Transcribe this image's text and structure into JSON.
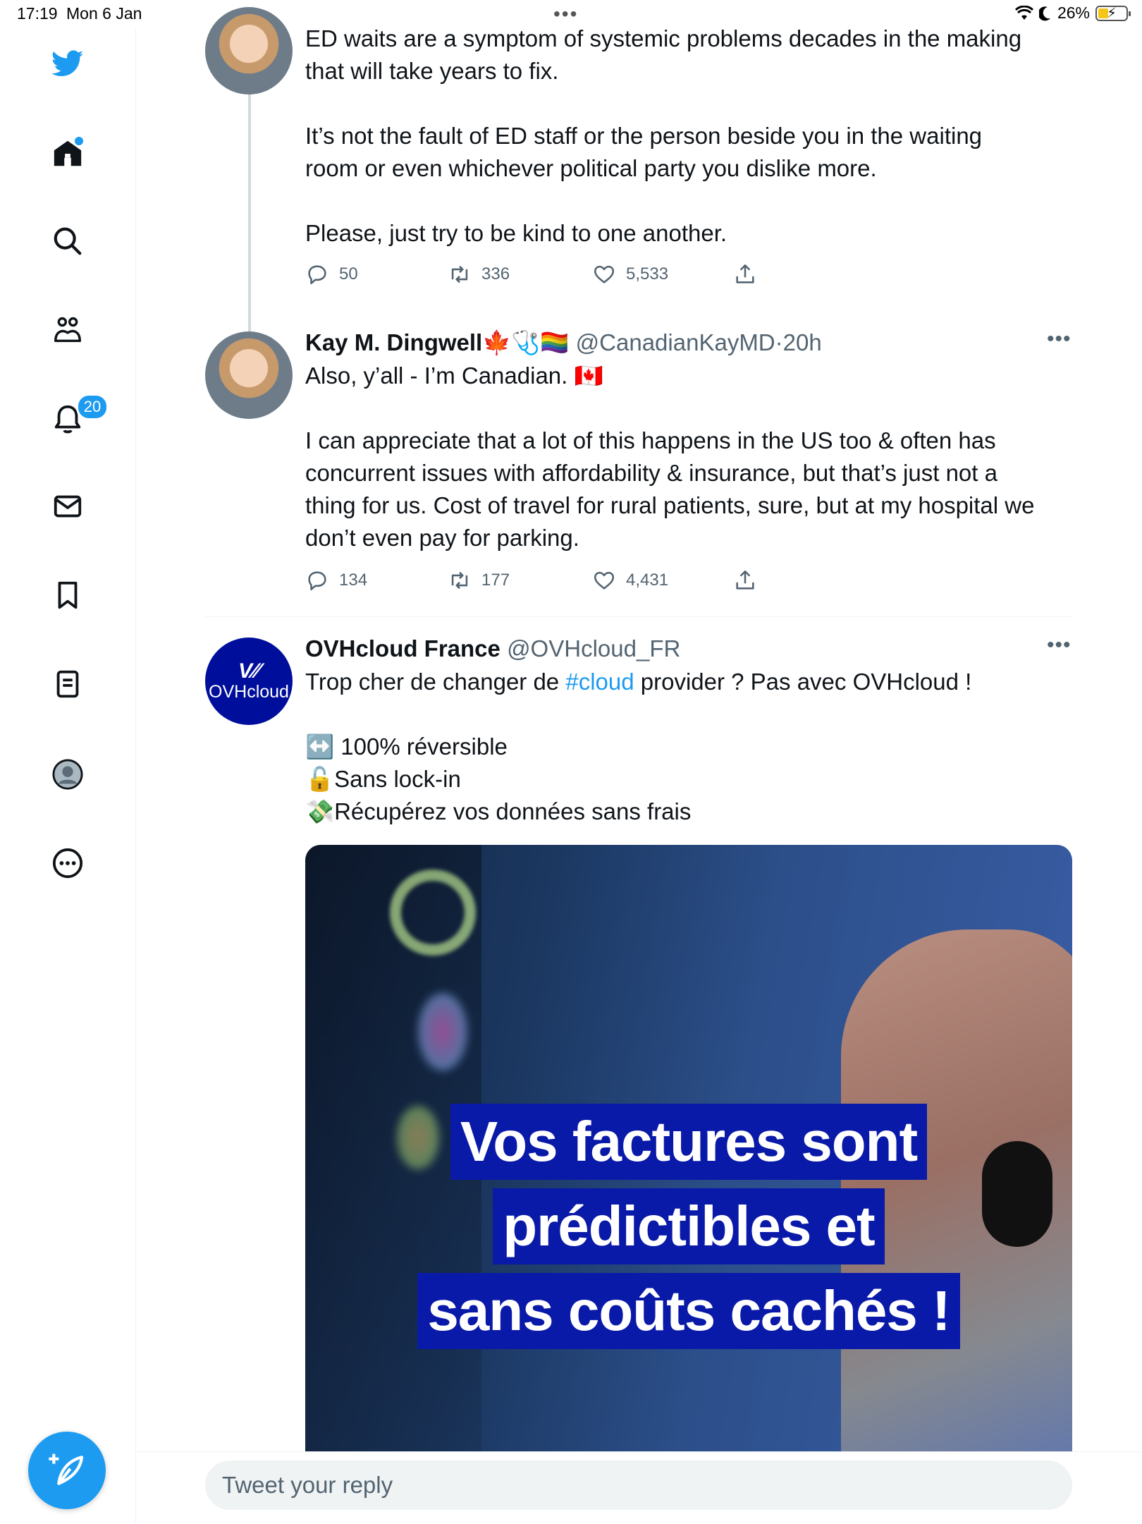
{
  "status_bar": {
    "time": "17:19",
    "date": "Mon 6 Jan",
    "battery": "26%"
  },
  "sidebar": {
    "notifications_badge": "20",
    "items": [
      "twitter-logo",
      "home",
      "explore",
      "communities",
      "notifications",
      "messages",
      "bookmarks",
      "lists",
      "profile",
      "more"
    ]
  },
  "tweets": [
    {
      "text": "ED waits are a symptom of systemic problems decades in the making\nthat will take years to fix.\n\nIt’s not the fault of ED staff or the person beside you in the waiting\nroom or even whichever political party you dislike more.\n\nPlease, just try to be kind to one another.",
      "replies": "50",
      "retweets": "336",
      "likes": "5,533"
    },
    {
      "name": "Kay M. Dingwell",
      "name_emoji": "🍁🩺🏳️‍🌈",
      "handle": "@CanadianKayMD",
      "sep": "·",
      "time": "20h",
      "text_line1": "Also, y’all - I’m Canadian. 🇨🇦",
      "text_body": "I can appreciate that a lot of this happens in the US too & often has\nconcurrent issues with affordability & insurance, but that’s just not a\nthing for us. Cost of travel for rural patients, sure, but at my hospital we\ndon’t even pay for parking.",
      "replies": "134",
      "retweets": "177",
      "likes": "4,431"
    },
    {
      "name": "OVHcloud France",
      "handle": "@OVHcloud_FR",
      "avatar_label": "OVHcloud",
      "text_pre": "Trop cher de changer de ",
      "hashtag": "#cloud",
      "text_post": " provider ? Pas avec OVHcloud !",
      "bullets": [
        "↔️ 100% réversible",
        "🔓Sans lock-in",
        "💸Récupérez vos données sans frais"
      ],
      "media_caption": [
        "Vos factures sont",
        "prédictibles et",
        "sans coûts cachés !"
      ]
    }
  ],
  "reply": {
    "placeholder": "Tweet your reply"
  },
  "colors": {
    "accent": "#1d9bf0",
    "ovh_blue": "#000e9c",
    "text": "#0f1419",
    "muted": "#536471"
  }
}
